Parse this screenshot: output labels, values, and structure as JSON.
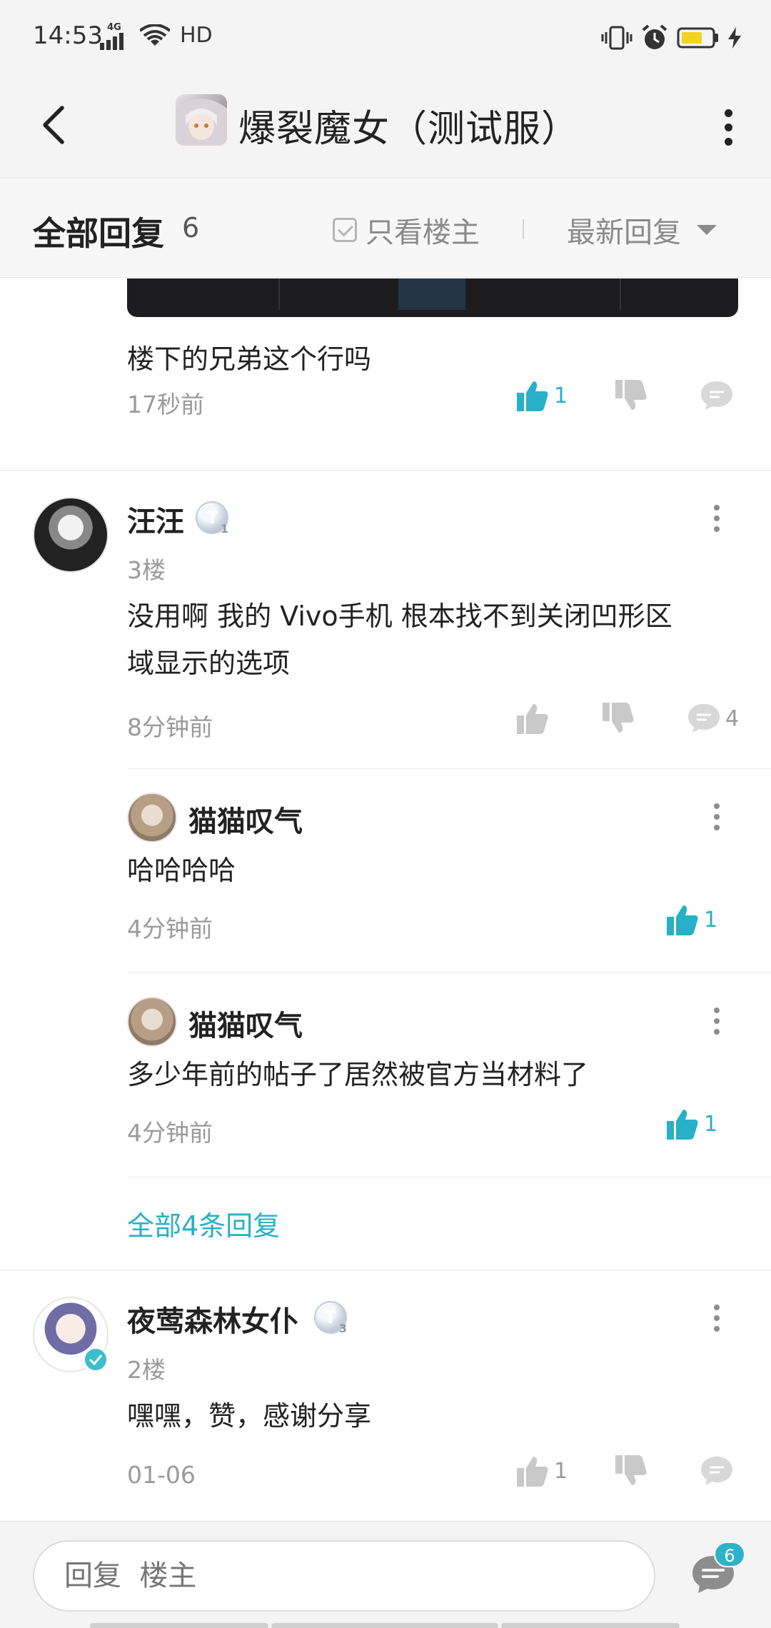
{
  "status_bar": {
    "time": "14:53",
    "network": "4G",
    "hd": "HD"
  },
  "header": {
    "title": "爆裂魔女（测试服）",
    "game_icon": "witch-avatar"
  },
  "filter": {
    "title": "全部回复",
    "count": "6",
    "only_owner": "只看楼主",
    "sort": "最新回复"
  },
  "comments": [
    {
      "text": "楼下的兄弟这个行吗",
      "time": "17秒前",
      "likes": "1",
      "liked": true
    },
    {
      "user": "汪汪",
      "level": "1",
      "floor": "3楼",
      "text_line1": "没用啊 我的 Vivo手机  根本找不到关闭凹形区",
      "text_line2": "域显示的选项",
      "time": "8分钟前",
      "comment_count": "4",
      "replies": [
        {
          "user": "猫猫叹气",
          "text": "哈哈哈哈",
          "time": "4分钟前",
          "likes": "1"
        },
        {
          "user": "猫猫叹气",
          "text": "多少年前的帖子了居然被官方当材料了",
          "time": "4分钟前",
          "likes": "1"
        }
      ],
      "all_replies_link": "全部4条回复"
    },
    {
      "user": "夜莺森林女仆",
      "level": "3",
      "floor": "2楼",
      "text": "嘿嘿，赞，感谢分享",
      "time": "01-06",
      "likes": "1"
    }
  ],
  "bottom": {
    "reply_placeholder": "回复  楼主",
    "badge": "6"
  },
  "colors": {
    "accent": "#28b0c8",
    "muted": "#9a9a9a"
  }
}
